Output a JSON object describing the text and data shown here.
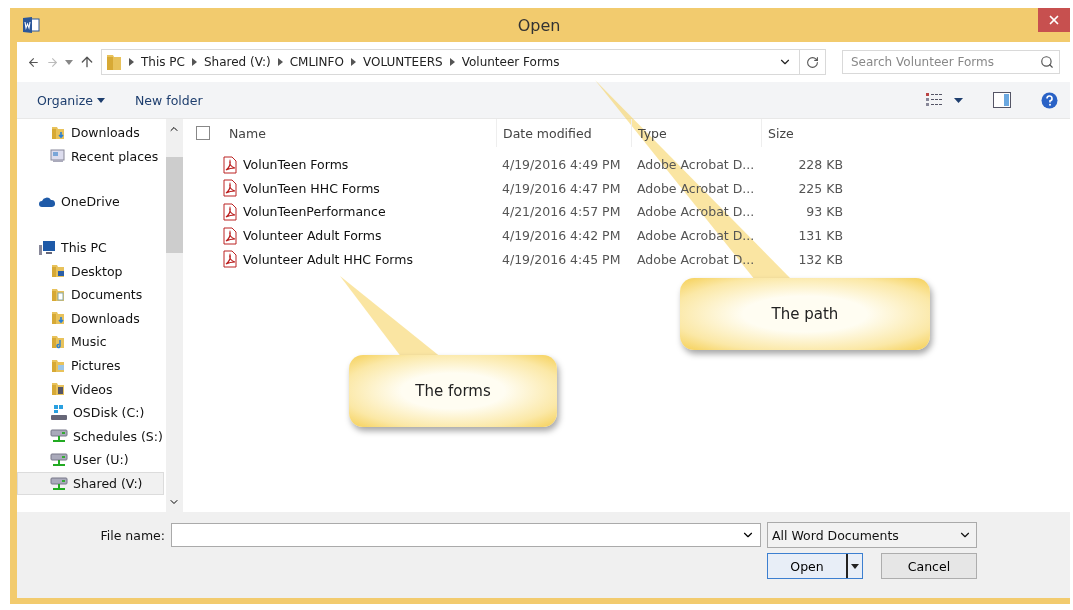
{
  "window": {
    "title": "Open"
  },
  "nav": {
    "path": [
      "This PC",
      "Shared (V:)",
      "CMLINFO",
      "VOLUNTEERS",
      "Volunteer Forms"
    ],
    "search": {
      "placeholder": "Search Volunteer Forms"
    }
  },
  "toolbar": {
    "organize": "Organize",
    "new_folder": "New folder"
  },
  "sidebar": {
    "scrolled_children": [
      {
        "label": "Downloads",
        "kind": "downloads",
        "selected": false
      },
      {
        "label": "Recent places",
        "kind": "recent",
        "selected": false
      }
    ],
    "items": [
      {
        "label": "OneDrive",
        "kind": "cloud",
        "selected": false
      },
      {
        "label": "This PC",
        "kind": "pc",
        "selected": false,
        "children": [
          {
            "label": "Desktop",
            "kind": "desktop",
            "selected": false
          },
          {
            "label": "Documents",
            "kind": "documents",
            "selected": false
          },
          {
            "label": "Downloads",
            "kind": "downloads",
            "selected": false
          },
          {
            "label": "Music",
            "kind": "music",
            "selected": false
          },
          {
            "label": "Pictures",
            "kind": "pictures",
            "selected": false
          },
          {
            "label": "Videos",
            "kind": "videos",
            "selected": false
          },
          {
            "label": "OSDisk (C:)",
            "kind": "disk",
            "selected": false
          },
          {
            "label": "Schedules (S:)",
            "kind": "network",
            "selected": false
          },
          {
            "label": "User (U:)",
            "kind": "network",
            "selected": false
          },
          {
            "label": "Shared (V:)",
            "kind": "network",
            "selected": true
          }
        ]
      }
    ]
  },
  "table": {
    "select_all": {
      "checked": false
    },
    "columns": [
      "Name",
      "Date modified",
      "Type",
      "Size"
    ],
    "rows": [
      {
        "name": "VolunTeen Forms",
        "date": "4/19/2016 4:49 PM",
        "type": "Adobe Acrobat D...",
        "size": "228 KB"
      },
      {
        "name": "VolunTeen HHC Forms",
        "date": "4/19/2016 4:47 PM",
        "type": "Adobe Acrobat D...",
        "size": "225 KB"
      },
      {
        "name": "VolunTeenPerformance",
        "date": "4/21/2016 4:57 PM",
        "type": "Adobe Acrobat D...",
        "size": "93 KB"
      },
      {
        "name": "Volunteer Adult Forms",
        "date": "4/19/2016 4:42 PM",
        "type": "Adobe Acrobat D...",
        "size": "131 KB"
      },
      {
        "name": "Volunteer Adult HHC Forms",
        "date": "4/19/2016 4:45 PM",
        "type": "Adobe Acrobat D...",
        "size": "132 KB"
      }
    ]
  },
  "footer": {
    "file_name_label": "File name:",
    "file_type": "All Word Documents",
    "open": "Open",
    "cancel": "Cancel"
  },
  "callouts": [
    {
      "text": "The path"
    },
    {
      "text": "The forms"
    }
  ]
}
